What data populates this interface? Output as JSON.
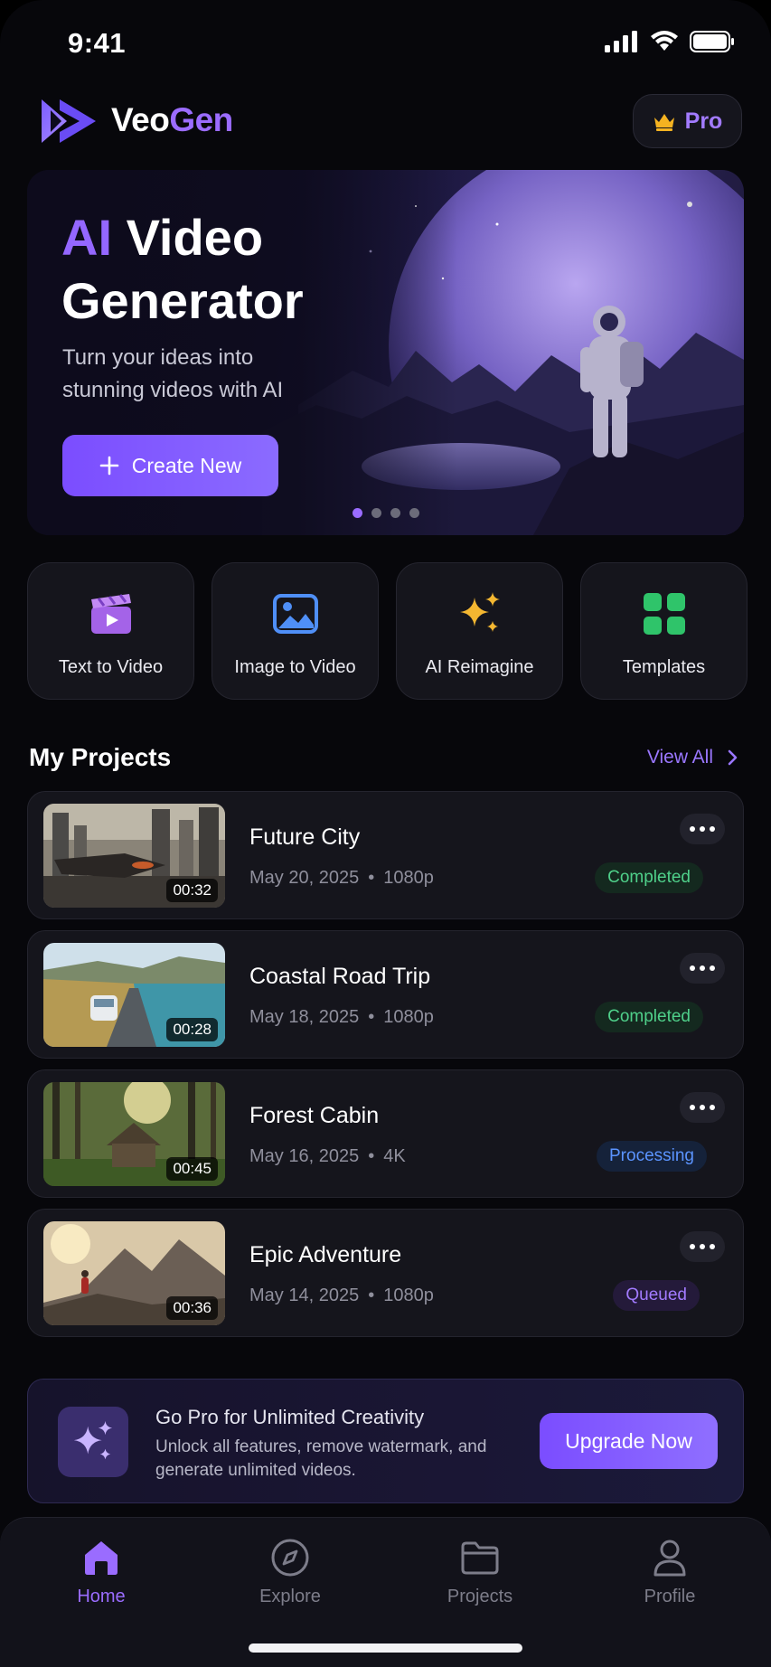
{
  "status_bar": {
    "time": "9:41"
  },
  "header": {
    "brand_part1": "Veo",
    "brand_part2": "Gen",
    "pro_label": "Pro"
  },
  "hero": {
    "title_accent": "AI",
    "title_rest": "Video",
    "title_line2": "Generator",
    "subtitle": "Turn your ideas into stunning videos with AI",
    "cta_label": "Create New",
    "page_count": 4,
    "active_page": 1
  },
  "quick_actions": [
    {
      "label": "Text to Video",
      "icon": "clapperboard-icon"
    },
    {
      "label": "Image to Video",
      "icon": "image-icon"
    },
    {
      "label": "AI Reimagine",
      "icon": "sparkles-icon"
    },
    {
      "label": "Templates",
      "icon": "grid-icon"
    }
  ],
  "projects_section": {
    "title": "My Projects",
    "view_all": "View All"
  },
  "projects": [
    {
      "title": "Future City",
      "date": "May 20, 2025",
      "resolution": "1080p",
      "duration": "00:32",
      "status": "Completed"
    },
    {
      "title": "Coastal Road Trip",
      "date": "May 18, 2025",
      "resolution": "1080p",
      "duration": "00:28",
      "status": "Completed"
    },
    {
      "title": "Forest Cabin",
      "date": "May 16, 2025",
      "resolution": "4K",
      "duration": "00:45",
      "status": "Processing"
    },
    {
      "title": "Epic Adventure",
      "date": "May 14, 2025",
      "resolution": "1080p",
      "duration": "00:36",
      "status": "Queued"
    }
  ],
  "promo": {
    "title": "Go Pro for Unlimited Creativity",
    "description": "Unlock all features, remove watermark, and generate unlimited videos.",
    "cta_label": "Upgrade Now"
  },
  "tab_bar": [
    {
      "label": "Home",
      "icon": "home-icon",
      "active": true
    },
    {
      "label": "Explore",
      "icon": "compass-icon",
      "active": false
    },
    {
      "label": "Projects",
      "icon": "folder-icon",
      "active": false
    },
    {
      "label": "Profile",
      "icon": "user-icon",
      "active": false
    }
  ],
  "colors": {
    "accent": "#9467ff",
    "completed": "#4fd08a",
    "processing": "#5b94ff",
    "queued": "#a27bff",
    "background": "#07070b"
  }
}
